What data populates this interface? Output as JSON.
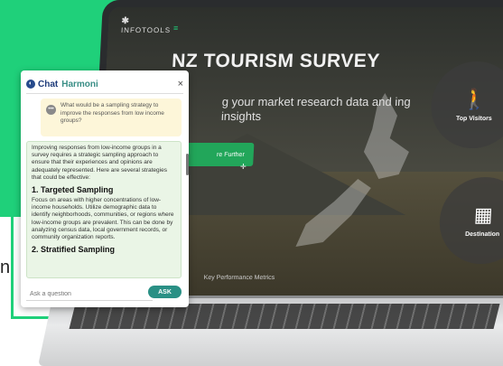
{
  "background": {
    "accent_color": "#1fd07a",
    "side_letter": "n"
  },
  "laptop_screen": {
    "logo_mark": "✱",
    "logo_text": "INFOTOOLS",
    "title": "NZ TOURISM SURVEY",
    "subtitle": "g your market research data and ing insights",
    "explore_button": "re Further",
    "footer_label": "Key Performance Metrics",
    "circles": [
      {
        "label": "Top Visitors",
        "icon": "hiker-icon"
      },
      {
        "label": "Destination",
        "icon": "building-icon"
      }
    ]
  },
  "chat": {
    "title": "Chat",
    "brand": "Harmoni",
    "close_glyph": "×",
    "question": "What would be a sampling strategy to improve the responses from low income groups?",
    "answer_intro": "Improving responses from low-income groups in a survey requires a strategic sampling approach to ensure that their experiences and opinions are adequately represented. Here are several strategies that could be effective:",
    "sections": [
      {
        "heading": "1. Targeted Sampling",
        "body": "Focus on areas with higher concentrations of low-income households. Utilize demographic data to identify neighborhoods, communities, or regions where low-income groups are prevalent. This can be done by analyzing census data, local government records, or community organization reports."
      },
      {
        "heading": "2. Stratified Sampling",
        "body": ""
      }
    ],
    "input_placeholder": "Ask a question",
    "ask_button": "ASK",
    "colors": {
      "header": "#1e3b7a",
      "brand": "#3a8e86",
      "question_bg": "#fdf6d9",
      "answer_bg": "#eaf5e6",
      "button": "#2a9085"
    }
  }
}
